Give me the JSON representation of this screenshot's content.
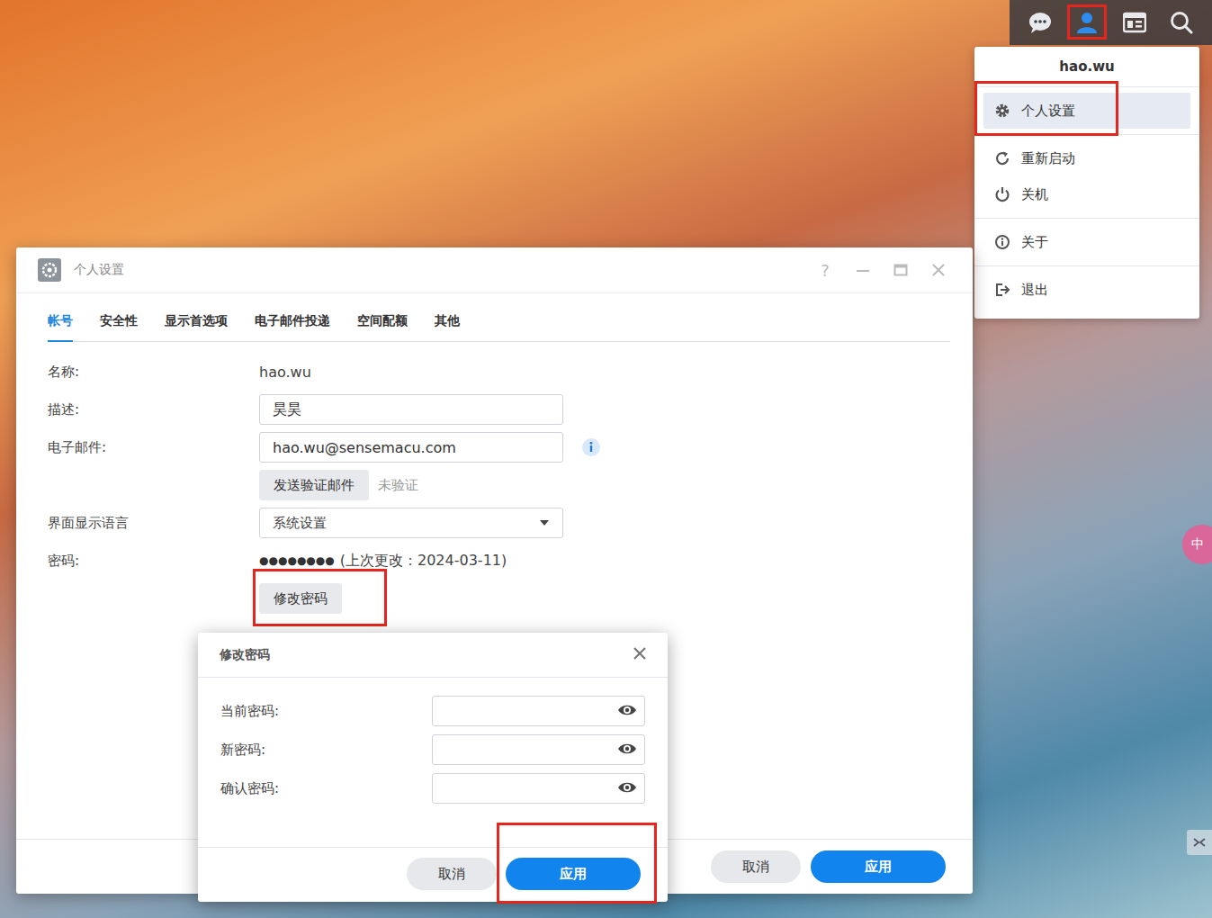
{
  "taskbar": {
    "items": [
      {
        "kind": "chat",
        "selected": false,
        "highlighted": false
      },
      {
        "kind": "user",
        "selected": true,
        "highlighted": true
      },
      {
        "kind": "widgets",
        "selected": false,
        "highlighted": false
      },
      {
        "kind": "search",
        "selected": false,
        "highlighted": false
      }
    ]
  },
  "user_menu": {
    "username": "hao.wu",
    "groups": [
      [
        {
          "label": "个人设置",
          "kind": "gear",
          "selected": true,
          "highlighted": true
        }
      ],
      [
        {
          "label": "重新启动",
          "kind": "restart",
          "selected": false,
          "highlighted": false
        },
        {
          "label": "关机",
          "kind": "power",
          "selected": false,
          "highlighted": false
        }
      ],
      [
        {
          "label": "关于",
          "kind": "info",
          "selected": false,
          "highlighted": false
        }
      ],
      [
        {
          "label": "退出",
          "kind": "logout",
          "selected": false,
          "highlighted": false
        }
      ]
    ]
  },
  "window": {
    "title": "个人设置",
    "help": "?"
  },
  "tabs": [
    {
      "label": "帐号",
      "selected": true
    },
    {
      "label": "安全性",
      "selected": false
    },
    {
      "label": "显示首选项",
      "selected": false
    },
    {
      "label": "电子邮件投递",
      "selected": false
    },
    {
      "label": "空间配额",
      "selected": false
    },
    {
      "label": "其他",
      "selected": false
    }
  ],
  "form": {
    "rows": [
      {
        "kind": "text",
        "label": "名称:",
        "value": "hao.wu"
      },
      {
        "kind": "input",
        "label": "描述:",
        "value": "昊昊",
        "info": false
      },
      {
        "kind": "input",
        "label": "电子邮件:",
        "value": "hao.wu@sensemacu.com",
        "info": true
      },
      {
        "kind": "button",
        "button": "发送验证邮件",
        "status": "未验证",
        "highlighted": false
      },
      {
        "kind": "select",
        "label": "界面显示语言",
        "value": "系统设置"
      },
      {
        "kind": "password",
        "label": "密码:",
        "mask": "●●●●●●●●",
        "note": "(上次更改：2024-03-11)"
      },
      {
        "kind": "button",
        "button": "修改密码",
        "highlighted": true
      }
    ]
  },
  "footer_buttons": [
    {
      "label": "取消",
      "kind": "secondary",
      "highlighted": false
    },
    {
      "label": "应用",
      "kind": "primary",
      "highlighted": false
    }
  ],
  "dialog": {
    "title": "修改密码",
    "fields": [
      {
        "label": "当前密码:",
        "value": ""
      },
      {
        "label": "新密码:",
        "value": ""
      },
      {
        "label": "确认密码:",
        "value": ""
      }
    ],
    "buttons": [
      {
        "label": "取消",
        "kind": "secondary",
        "highlighted": false
      },
      {
        "label": "应用",
        "kind": "primary",
        "highlighted": true
      }
    ]
  },
  "ime": {
    "label": "中"
  }
}
